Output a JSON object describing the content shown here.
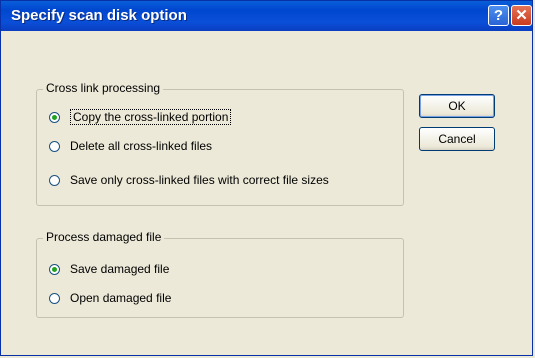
{
  "window": {
    "title": "Specify scan disk option",
    "help_glyph": "?",
    "close_glyph": "✕"
  },
  "cross_link_group": {
    "title": "Cross link processing",
    "options": [
      {
        "label": "Copy the cross-linked portion",
        "checked": true
      },
      {
        "label": "Delete all cross-linked files",
        "checked": false
      },
      {
        "label": "Save only cross-linked files with correct file sizes",
        "checked": false
      }
    ]
  },
  "damaged_group": {
    "title": "Process damaged file",
    "options": [
      {
        "label": "Save damaged file",
        "checked": true
      },
      {
        "label": "Open damaged file",
        "checked": false
      }
    ]
  },
  "buttons": {
    "ok": "OK",
    "cancel": "Cancel"
  },
  "icons": {
    "help": "help-icon",
    "close": "close-icon"
  },
  "colors": {
    "titlebar": "#0a4fd8",
    "dialog_bg": "#ece9d8",
    "close_button": "#c93b1e",
    "radio_dot": "#21a121"
  }
}
